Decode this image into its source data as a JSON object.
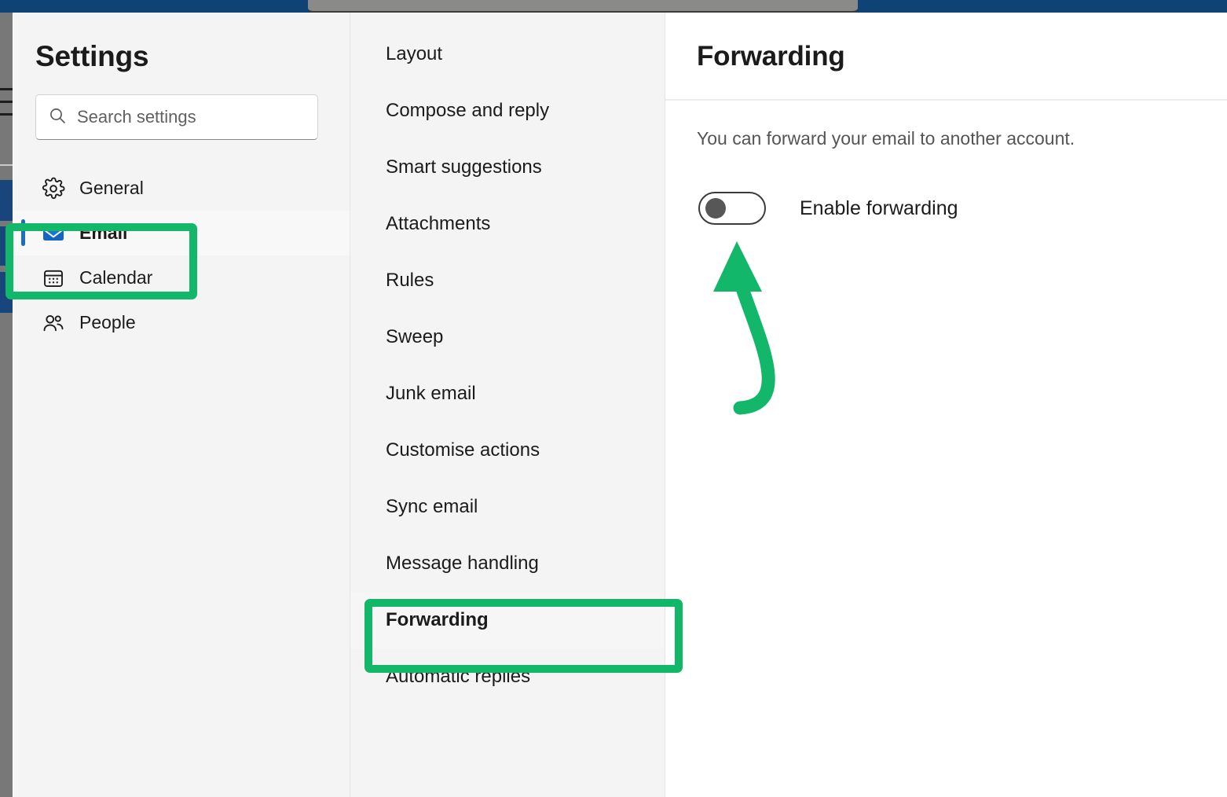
{
  "window": {
    "background_app_visible": true
  },
  "colors": {
    "annotation_green": "#12b76a",
    "accent_blue": "#1b6ec2",
    "panel_gray": "#f4f4f4",
    "top_bar_blue": "#0f4275",
    "toggle_knob_gray": "#575757"
  },
  "settings": {
    "title": "Settings",
    "search": {
      "placeholder": "Search settings",
      "value": "",
      "icon": "search-icon"
    },
    "nav_items": [
      {
        "id": "general",
        "label": "General",
        "icon": "gear-icon",
        "selected": false
      },
      {
        "id": "email",
        "label": "Email",
        "icon": "envelope-icon",
        "selected": true
      },
      {
        "id": "calendar",
        "label": "Calendar",
        "icon": "calendar-icon",
        "selected": false
      },
      {
        "id": "people",
        "label": "People",
        "icon": "people-icon",
        "selected": false
      }
    ]
  },
  "sub_nav": {
    "items": [
      {
        "id": "layout",
        "label": "Layout",
        "selected": false
      },
      {
        "id": "compose-and-reply",
        "label": "Compose and reply",
        "selected": false
      },
      {
        "id": "smart-suggestions",
        "label": "Smart suggestions",
        "selected": false
      },
      {
        "id": "attachments",
        "label": "Attachments",
        "selected": false
      },
      {
        "id": "rules",
        "label": "Rules",
        "selected": false
      },
      {
        "id": "sweep",
        "label": "Sweep",
        "selected": false
      },
      {
        "id": "junk-email",
        "label": "Junk email",
        "selected": false
      },
      {
        "id": "customise-actions",
        "label": "Customise actions",
        "selected": false
      },
      {
        "id": "sync-email",
        "label": "Sync email",
        "selected": false
      },
      {
        "id": "message-handling",
        "label": "Message handling",
        "selected": false
      },
      {
        "id": "forwarding",
        "label": "Forwarding",
        "selected": true
      },
      {
        "id": "automatic-replies",
        "label": "Automatic replies",
        "selected": false
      }
    ]
  },
  "detail": {
    "title": "Forwarding",
    "description": "You can forward your email to another account.",
    "toggle": {
      "label": "Enable forwarding",
      "state": "off"
    }
  },
  "annotations": {
    "highlight_email": {
      "target": "Email",
      "color": "#12b76a"
    },
    "highlight_forwarding": {
      "target": "Forwarding",
      "color": "#12b76a"
    },
    "arrow": {
      "points_to": "Enable forwarding toggle",
      "color": "#12b76a"
    }
  }
}
